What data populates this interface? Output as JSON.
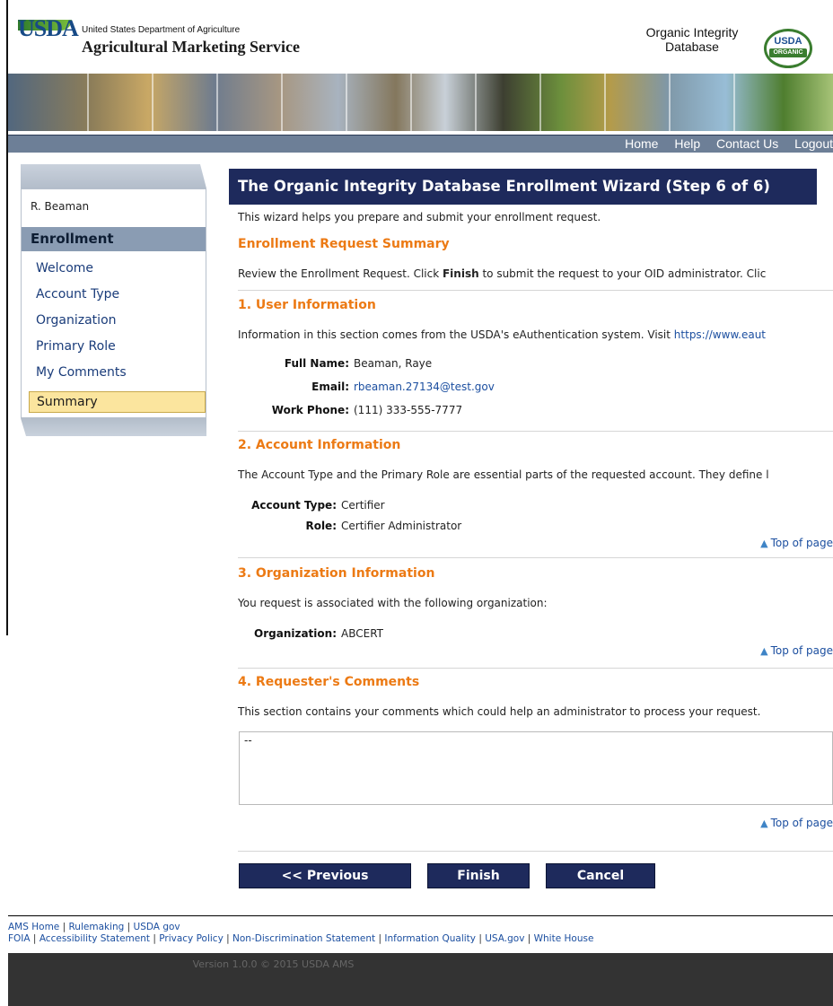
{
  "header": {
    "usda_logo": "USDA",
    "department": "United States Department of Agriculture",
    "agency": "Agricultural Marketing Service",
    "oid_line1": "Organic Integrity",
    "oid_line2": "Database",
    "seal_top": "USDA",
    "seal_bottom": "ORGANIC"
  },
  "topnav": {
    "home": "Home",
    "help": "Help",
    "contact": "Contact Us",
    "logout": "Logout"
  },
  "sidebar": {
    "user": "R. Beaman",
    "heading": "Enrollment",
    "items": [
      {
        "label": "Welcome"
      },
      {
        "label": "Account Type"
      },
      {
        "label": "Organization"
      },
      {
        "label": "Primary Role"
      },
      {
        "label": "My Comments"
      },
      {
        "label": "Summary"
      }
    ]
  },
  "main": {
    "title": "The Organic Integrity Database Enrollment Wizard (Step 6 of 6)",
    "intro": "This wizard helps you prepare and submit your enrollment request.",
    "summary_heading": "Enrollment Request Summary",
    "summary_text_before": "Review the Enrollment Request. Click ",
    "summary_text_bold": "Finish",
    "summary_text_after": " to submit the request to your OID administrator. Clic",
    "user_info": {
      "heading": "1. User Information",
      "text_before": "Information in this section comes from the USDA's eAuthentication system. Visit ",
      "text_link": "https://www.eaut",
      "full_name_label": "Full Name:",
      "full_name": "Beaman, Raye",
      "email_label": "Email:",
      "email": "rbeaman.27134@test.gov",
      "phone_label": "Work Phone:",
      "phone": "(111) 333-555-7777"
    },
    "account_info": {
      "heading": "2. Account Information",
      "text": "The Account Type and the Primary Role are essential parts of the requested account. They define l",
      "type_label": "Account Type:",
      "type": "Certifier",
      "role_label": "Role:",
      "role": "Certifier Administrator"
    },
    "org_info": {
      "heading": "3. Organization Information",
      "text": "You request is associated with the following organization:",
      "org_label": "Organization:",
      "org": "ABCERT"
    },
    "comments": {
      "heading": "4. Requester's Comments",
      "text": "This section contains your comments which could help an administrator to process your request.",
      "value": "--"
    },
    "top_of_page": "Top of page",
    "buttons": {
      "previous": "<< Previous",
      "finish": "Finish",
      "cancel": "Cancel"
    }
  },
  "footer": {
    "links_row1": [
      "AMS Home",
      "Rulemaking",
      "USDA gov"
    ],
    "links_row2": [
      "FOIA",
      "Accessibility Statement",
      "Privacy Policy",
      "Non-Discrimination Statement",
      "Information Quality",
      "USA.gov",
      "White House"
    ],
    "version": "Version 1.0.0 © 2015 USDA AMS"
  }
}
